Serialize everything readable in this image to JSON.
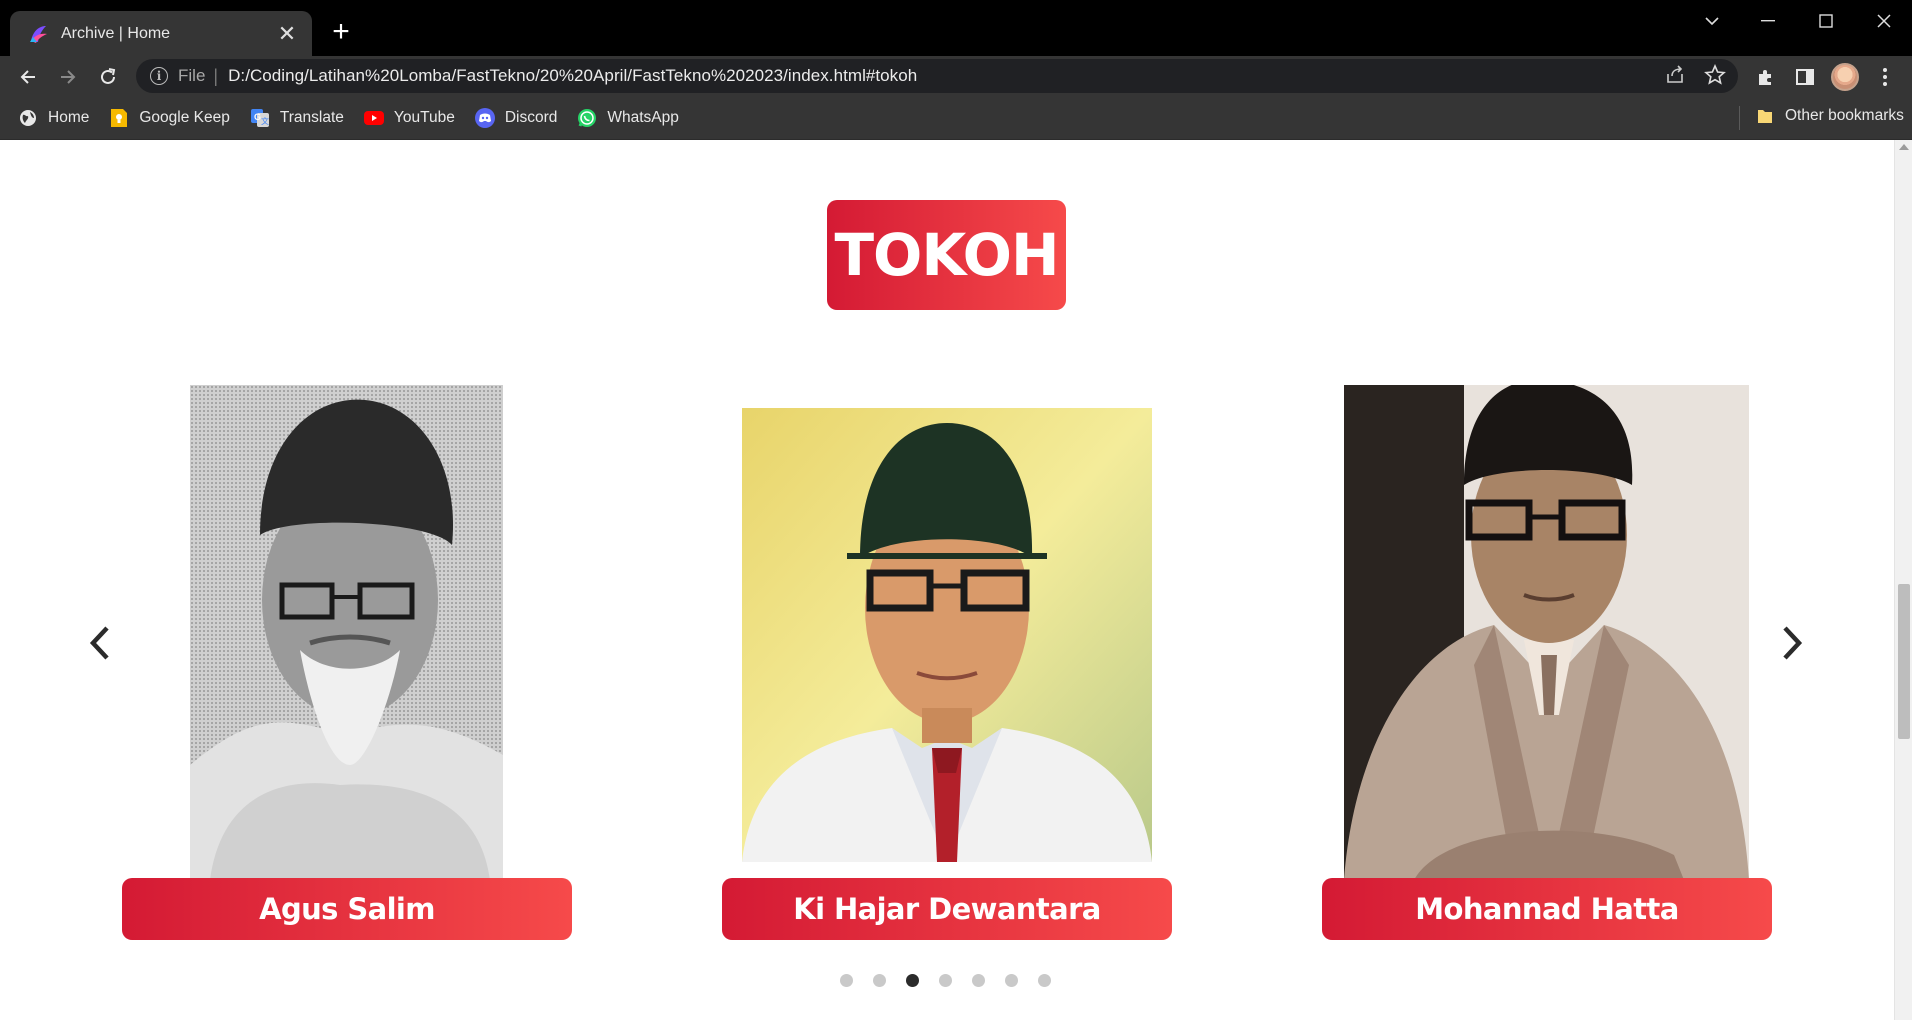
{
  "browser": {
    "tab_title": "Archive | Home",
    "address": {
      "scheme_label": "File",
      "url": "D:/Coding/Latihan%20Lomba/FastTekno/20%20April/FastTekno%202023/index.html#tokoh"
    },
    "bookmarks": [
      {
        "label": "Home",
        "icon": "globe-icon"
      },
      {
        "label": "Google Keep",
        "icon": "google-keep-icon"
      },
      {
        "label": "Translate",
        "icon": "translate-icon"
      },
      {
        "label": "YouTube",
        "icon": "youtube-icon"
      },
      {
        "label": "Discord",
        "icon": "discord-icon"
      },
      {
        "label": "WhatsApp",
        "icon": "whatsapp-icon"
      }
    ],
    "other_bookmarks": "Other bookmarks"
  },
  "page": {
    "section_title": "TOKOH",
    "figures": [
      {
        "name": "Agus Salim",
        "photo_style": "grayscale halftone portrait"
      },
      {
        "name": "Ki Hajar Dewantara",
        "photo_style": "color painted portrait"
      },
      {
        "name": "Mohannad Hatta",
        "photo_style": "sepia photograph"
      }
    ],
    "carousel": {
      "dot_count": 7,
      "active_index": 2
    },
    "colors": {
      "accent_start": "#d41a34",
      "accent_end": "#f64a4a"
    }
  }
}
